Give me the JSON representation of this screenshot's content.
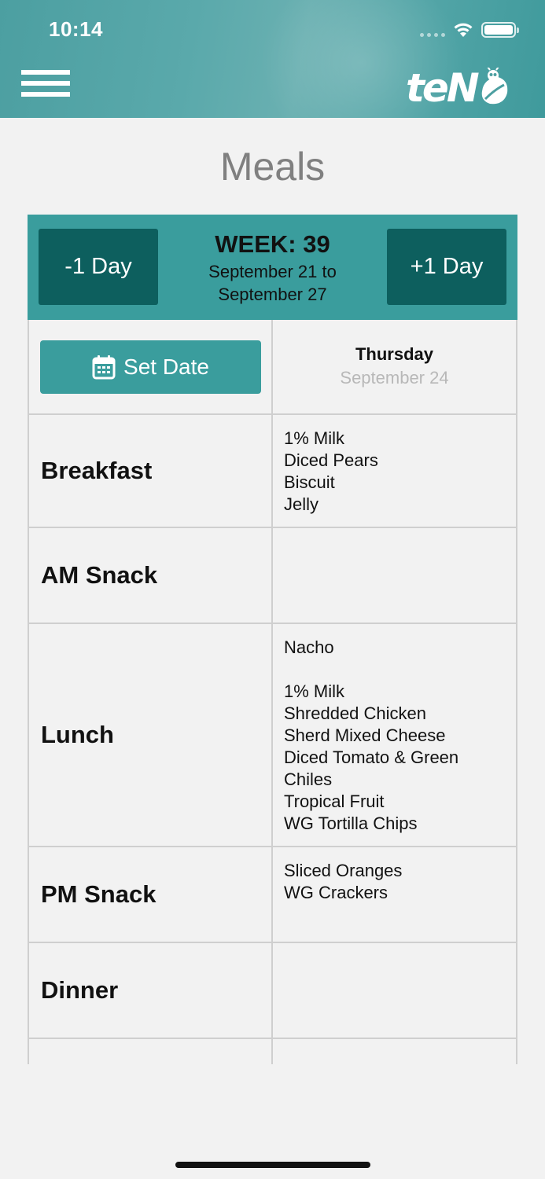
{
  "status_bar": {
    "time": "10:14"
  },
  "header": {
    "logo_text": "teN"
  },
  "page": {
    "title": "Meals"
  },
  "week_nav": {
    "prev_label": "-1 Day",
    "next_label": "+1 Day",
    "week_label": "WEEK: 39",
    "range_line1": "September 21 to",
    "range_line2": "September 27"
  },
  "date_row": {
    "set_date_label": "Set Date",
    "day_name": "Thursday",
    "day_date": "September 24"
  },
  "meals": [
    {
      "name": "Breakfast",
      "items": "1% Milk\nDiced Pears\nBiscuit\nJelly"
    },
    {
      "name": "AM Snack",
      "items": ""
    },
    {
      "name": "Lunch",
      "items": "Nacho\n\n1% Milk\nShredded Chicken\nSherd Mixed Cheese\nDiced Tomato & Green Chiles\nTropical Fruit\nWG Tortilla Chips"
    },
    {
      "name": "PM Snack",
      "items": "Sliced Oranges\nWG Crackers"
    },
    {
      "name": "Dinner",
      "items": ""
    }
  ],
  "colors": {
    "header_teal": "#4c9fa1",
    "bar_teal": "#3a9d9d",
    "button_dark_teal": "#0d5f5e",
    "page_bg": "#f2f2f2"
  }
}
